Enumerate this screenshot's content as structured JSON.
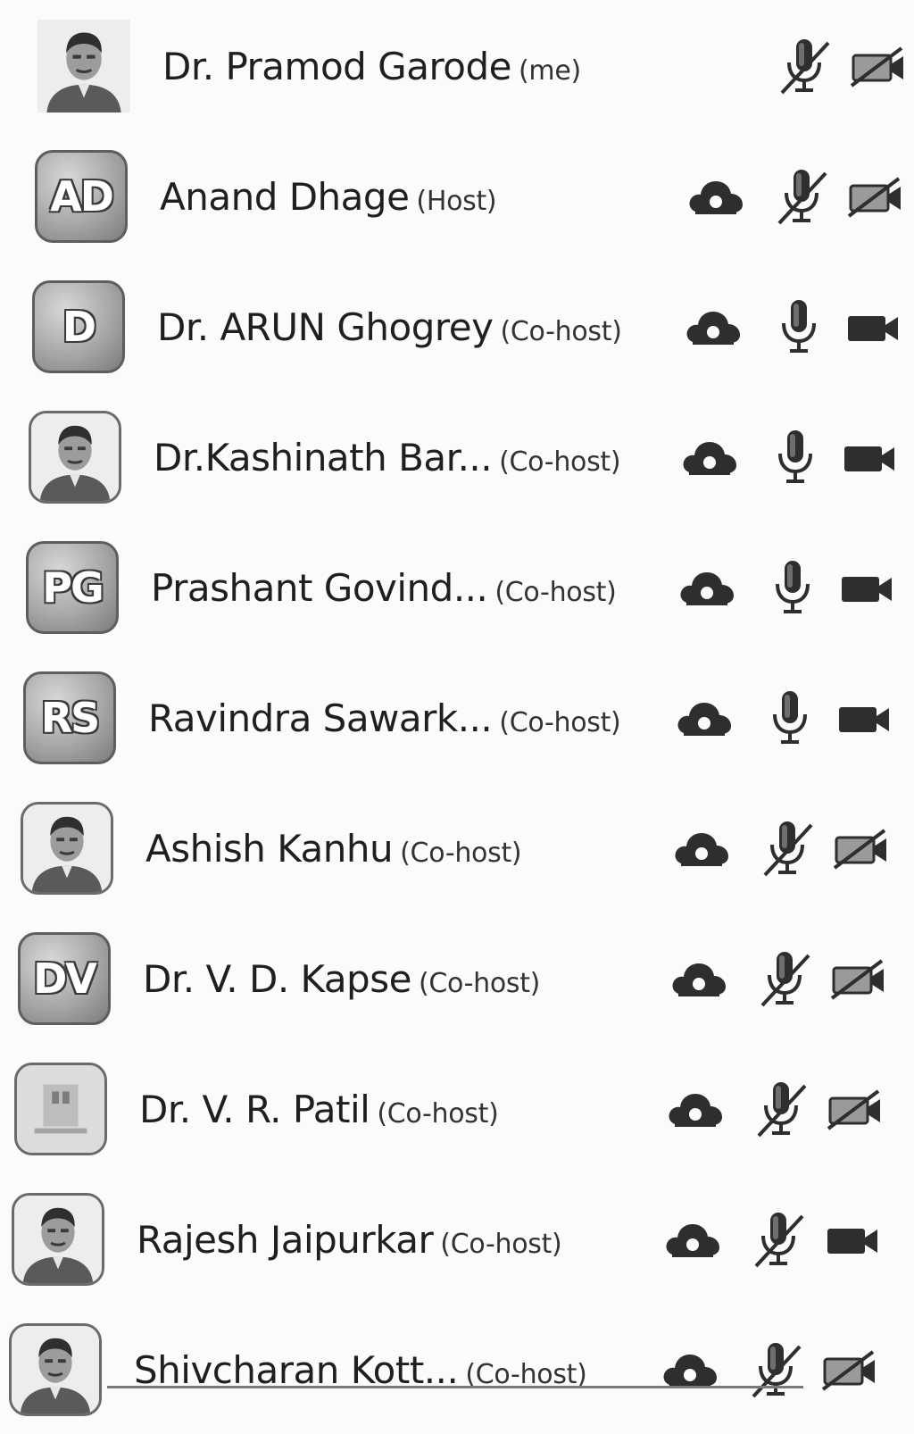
{
  "participants": [
    {
      "name": "Dr. Pramod Garode",
      "role": "(me)",
      "avatar": {
        "type": "photo",
        "label": "portrait"
      },
      "cloud": false,
      "mic_muted": true,
      "video_off": true
    },
    {
      "name": "Anand Dhage",
      "role": "(Host)",
      "avatar": {
        "type": "initials",
        "text": "AD"
      },
      "cloud": true,
      "mic_muted": true,
      "video_off": true
    },
    {
      "name": "Dr. ARUN Ghogrey",
      "role": "(Co-host)",
      "avatar": {
        "type": "initials",
        "text": "D"
      },
      "cloud": true,
      "mic_muted": false,
      "video_off": false
    },
    {
      "name": "Dr.Kashinath Bar...",
      "role": "(Co-host)",
      "avatar": {
        "type": "photo",
        "label": "portrait"
      },
      "cloud": true,
      "mic_muted": false,
      "video_off": false
    },
    {
      "name": "Prashant Govind...",
      "role": "(Co-host)",
      "avatar": {
        "type": "initials",
        "text": "PG"
      },
      "cloud": true,
      "mic_muted": false,
      "video_off": false
    },
    {
      "name": "Ravindra Sawark...",
      "role": "(Co-host)",
      "avatar": {
        "type": "initials",
        "text": "RS"
      },
      "cloud": true,
      "mic_muted": false,
      "video_off": false
    },
    {
      "name": "Ashish Kanhu",
      "role": "(Co-host)",
      "avatar": {
        "type": "photo",
        "label": "portrait"
      },
      "cloud": true,
      "mic_muted": true,
      "video_off": true
    },
    {
      "name": "Dr. V. D. Kapse",
      "role": "(Co-host)",
      "avatar": {
        "type": "initials",
        "text": "DV"
      },
      "cloud": true,
      "mic_muted": true,
      "video_off": true
    },
    {
      "name": "Dr. V. R. Patil",
      "role": "(Co-host)",
      "avatar": {
        "type": "photo",
        "label": "logo"
      },
      "cloud": true,
      "mic_muted": true,
      "video_off": true
    },
    {
      "name": "Rajesh Jaipurkar",
      "role": "(Co-host)",
      "avatar": {
        "type": "photo",
        "label": "portrait"
      },
      "cloud": true,
      "mic_muted": true,
      "video_off": false
    },
    {
      "name": "Shivcharan Kott...",
      "role": "(Co-host)",
      "avatar": {
        "type": "photo",
        "label": "portrait"
      },
      "cloud": true,
      "mic_muted": true,
      "video_off": true
    }
  ],
  "colors": {
    "icon": "#2e2e2e",
    "icon_light": "#6b6b6b",
    "text": "#1f1f1f"
  },
  "icons": {
    "cloud": "cloud-icon",
    "mic": "microphone-icon",
    "mic_muted": "microphone-muted-icon",
    "video": "video-camera-icon",
    "video_off": "video-off-icon"
  }
}
